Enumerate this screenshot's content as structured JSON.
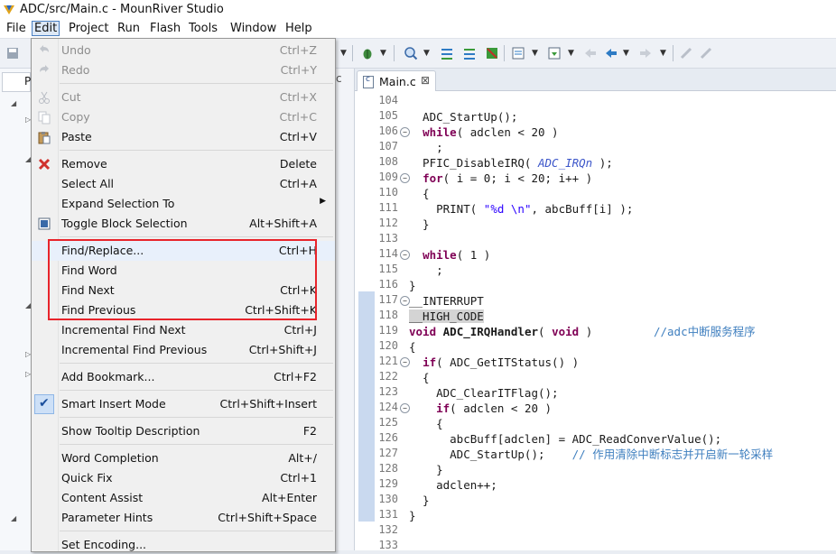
{
  "window": {
    "title": "ADC/src/Main.c - MounRiver Studio"
  },
  "menubar": {
    "items": [
      "File",
      "Edit",
      "Project",
      "Run",
      "Flash",
      "Tools",
      "Window",
      "Help"
    ],
    "active": "Edit"
  },
  "left_panel": {
    "tab_fragment": "P"
  },
  "mid_strip": {
    "fragment": "c"
  },
  "editor": {
    "tab": {
      "label": "Main.c",
      "close": "⊠"
    },
    "lines": [
      {
        "n": "104",
        "fold": "",
        "html": ""
      },
      {
        "n": "105",
        "fold": "",
        "html": "  ADC_StartUp();"
      },
      {
        "n": "106",
        "fold": "⊖",
        "html": "  <span class='kw'>while</span>( adclen &lt; 20 )"
      },
      {
        "n": "107",
        "fold": "",
        "html": "    ;"
      },
      {
        "n": "108",
        "fold": "",
        "html": "  PFIC_DisableIRQ( <span class='mac'>ADC_IRQn</span> );"
      },
      {
        "n": "109",
        "fold": "⊖",
        "html": "  <span class='kw'>for</span>( i = 0; i &lt; 20; i++ )"
      },
      {
        "n": "110",
        "fold": "",
        "html": "  {"
      },
      {
        "n": "111",
        "fold": "",
        "html": "    PRINT( <span class='str'>\"%d \\n\"</span>, abcBuff[i] );"
      },
      {
        "n": "112",
        "fold": "",
        "html": "  }"
      },
      {
        "n": "113",
        "fold": "",
        "html": ""
      },
      {
        "n": "114",
        "fold": "⊖",
        "html": "  <span class='kw'>while</span>( 1 )"
      },
      {
        "n": "115",
        "fold": "",
        "html": "    ;"
      },
      {
        "n": "116",
        "fold": "",
        "html": "}"
      },
      {
        "n": "117",
        "fold": "⊖",
        "html": "__INTERRUPT"
      },
      {
        "n": "118",
        "fold": "",
        "html": "<span class='hlbox'>__HIGH_CODE</span>"
      },
      {
        "n": "119",
        "fold": "",
        "html": "<span class='kw'>void</span> <b>ADC_IRQHandler</b>( <span class='kw'>void</span> )         <span class='cmt'>//adc中断服务程序</span>"
      },
      {
        "n": "120",
        "fold": "",
        "html": "{"
      },
      {
        "n": "121",
        "fold": "⊖",
        "html": "  <span class='kw'>if</span>( ADC_GetITStatus() )"
      },
      {
        "n": "122",
        "fold": "",
        "html": "  {"
      },
      {
        "n": "123",
        "fold": "",
        "html": "    ADC_ClearITFlag();"
      },
      {
        "n": "124",
        "fold": "⊖",
        "html": "    <span class='kw'>if</span>( adclen &lt; 20 )"
      },
      {
        "n": "125",
        "fold": "",
        "html": "    {"
      },
      {
        "n": "126",
        "fold": "",
        "html": "      abcBuff[adclen] = ADC_ReadConverValue();"
      },
      {
        "n": "127",
        "fold": "",
        "html": "      ADC_StartUp();    <span class='cmt'>// 作用清除中断标志并开启新一轮采样</span>"
      },
      {
        "n": "128",
        "fold": "",
        "html": "    }"
      },
      {
        "n": "129",
        "fold": "",
        "html": "    adclen++;"
      },
      {
        "n": "130",
        "fold": "",
        "html": "  }"
      },
      {
        "n": "131",
        "fold": "",
        "html": "}"
      },
      {
        "n": "132",
        "fold": "",
        "html": ""
      },
      {
        "n": "133",
        "fold": "",
        "html": ""
      }
    ]
  },
  "edit_menu": {
    "items": [
      {
        "label": "Undo",
        "shortcut": "Ctrl+Z",
        "disabled": true,
        "icon": "undo-icon"
      },
      {
        "label": "Redo",
        "shortcut": "Ctrl+Y",
        "disabled": true,
        "icon": "redo-icon"
      },
      {
        "sep": true
      },
      {
        "label": "Cut",
        "shortcut": "Ctrl+X",
        "disabled": true,
        "icon": "cut-icon"
      },
      {
        "label": "Copy",
        "shortcut": "Ctrl+C",
        "disabled": true,
        "icon": "copy-icon"
      },
      {
        "label": "Paste",
        "shortcut": "Ctrl+V",
        "disabled": false,
        "icon": "paste-icon"
      },
      {
        "sep": true
      },
      {
        "label": "Remove",
        "shortcut": "Delete",
        "disabled": false,
        "icon": "remove-icon"
      },
      {
        "label": "Select All",
        "shortcut": "Ctrl+A",
        "disabled": false,
        "icon": ""
      },
      {
        "label": "Expand Selection To",
        "shortcut": "",
        "disabled": false,
        "icon": "",
        "submenu": true
      },
      {
        "label": "Toggle Block Selection",
        "shortcut": "Alt+Shift+A",
        "disabled": false,
        "icon": "block-selection-icon"
      },
      {
        "sep": true
      },
      {
        "label": "Find/Replace...",
        "shortcut": "Ctrl+H",
        "disabled": false,
        "icon": "",
        "hover": true
      },
      {
        "label": "Find Word",
        "shortcut": "",
        "disabled": false,
        "icon": ""
      },
      {
        "label": "Find Next",
        "shortcut": "Ctrl+K",
        "disabled": false,
        "icon": ""
      },
      {
        "label": "Find Previous",
        "shortcut": "Ctrl+Shift+K",
        "disabled": false,
        "icon": ""
      },
      {
        "label": "Incremental Find Next",
        "shortcut": "Ctrl+J",
        "disabled": false,
        "icon": ""
      },
      {
        "label": "Incremental Find Previous",
        "shortcut": "Ctrl+Shift+J",
        "disabled": false,
        "icon": ""
      },
      {
        "sep": true
      },
      {
        "label": "Add Bookmark...",
        "shortcut": "Ctrl+F2",
        "disabled": false,
        "icon": ""
      },
      {
        "sep": true
      },
      {
        "label": "Smart Insert Mode",
        "shortcut": "Ctrl+Shift+Insert",
        "disabled": false,
        "icon": "checkmark-icon",
        "checked": true
      },
      {
        "sep": true
      },
      {
        "label": "Show Tooltip Description",
        "shortcut": "F2",
        "disabled": false,
        "icon": ""
      },
      {
        "sep": true
      },
      {
        "label": "Word Completion",
        "shortcut": "Alt+/",
        "disabled": false,
        "icon": ""
      },
      {
        "label": "Quick Fix",
        "shortcut": "Ctrl+1",
        "disabled": false,
        "icon": ""
      },
      {
        "label": "Content Assist",
        "shortcut": "Alt+Enter",
        "disabled": false,
        "icon": ""
      },
      {
        "label": "Parameter Hints",
        "shortcut": "Ctrl+Shift+Space",
        "disabled": false,
        "icon": ""
      },
      {
        "sep": true
      },
      {
        "label": "Set Encoding...",
        "shortcut": "",
        "disabled": false,
        "icon": ""
      }
    ]
  },
  "colors": {
    "highlight_box": "#e8242b",
    "keyword": "#7f0055",
    "comment": "#3f7fbf"
  }
}
